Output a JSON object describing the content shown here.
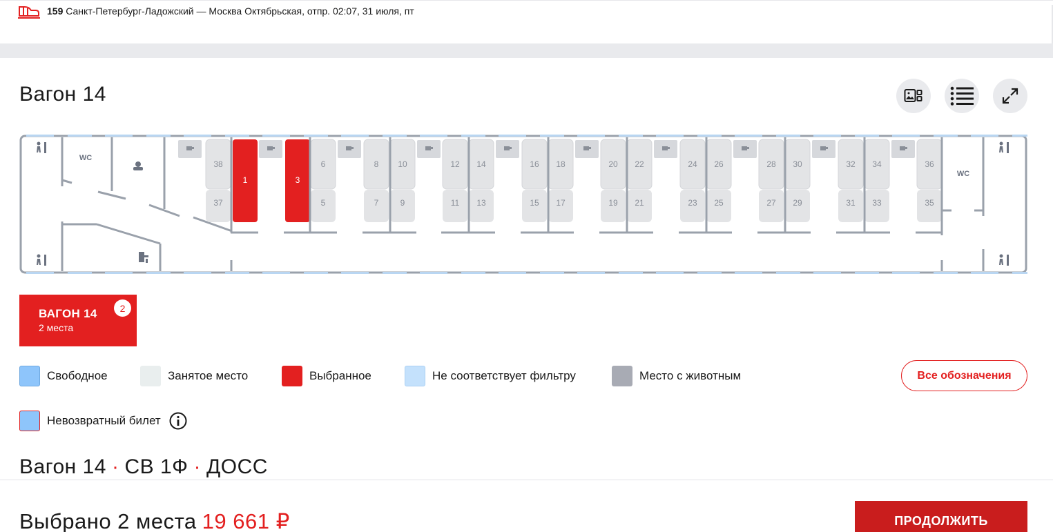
{
  "train": {
    "number": "159",
    "route": "Санкт-Петербург-Ладожский — Москва Октябрьская, отпр. 02:07, 31 июля, пт"
  },
  "wagon": {
    "title": "Вагон 14"
  },
  "toolbar": {
    "gallery_icon": "photo-gallery-icon",
    "list_icon": "list-icon",
    "expand_icon": "expand-icon"
  },
  "scheme": {
    "wc_left": "WC",
    "wc_right": "WC",
    "compartments": [
      {
        "upper": "38",
        "lower": "37",
        "selected": false
      },
      {
        "upper": "1",
        "lower": "",
        "selected": true
      },
      {
        "upper": "3",
        "lower": "",
        "selected": true
      },
      {
        "upper": "6",
        "lower": "5",
        "selected": false
      },
      {
        "upper": "8",
        "lower": "7",
        "selected": false
      },
      {
        "upper": "10",
        "lower": "9",
        "selected": false
      },
      {
        "upper": "12",
        "lower": "11",
        "selected": false
      },
      {
        "upper": "14",
        "lower": "13",
        "selected": false
      },
      {
        "upper": "16",
        "lower": "15",
        "selected": false
      },
      {
        "upper": "18",
        "lower": "17",
        "selected": false
      },
      {
        "upper": "20",
        "lower": "19",
        "selected": false
      },
      {
        "upper": "22",
        "lower": "21",
        "selected": false
      },
      {
        "upper": "24",
        "lower": "23",
        "selected": false
      },
      {
        "upper": "26",
        "lower": "25",
        "selected": false
      },
      {
        "upper": "28",
        "lower": "27",
        "selected": false
      },
      {
        "upper": "30",
        "lower": "29",
        "selected": false
      },
      {
        "upper": "32",
        "lower": "31",
        "selected": false
      },
      {
        "upper": "34",
        "lower": "33",
        "selected": false
      },
      {
        "upper": "36",
        "lower": "35",
        "selected": false
      }
    ]
  },
  "wagon_tab": {
    "title": "ВАГОН 14",
    "subtitle": "2 места",
    "badge": "2"
  },
  "legend": {
    "free": {
      "label": "Свободное",
      "color": "#8ec5fb"
    },
    "occupied": {
      "label": "Занятое место",
      "color": "#e9eeee"
    },
    "selected": {
      "label": "Выбранное",
      "color": "#e32020"
    },
    "not_matching": {
      "label": "Не соответствует фильтру",
      "color": "#c4e1fc"
    },
    "with_animal": {
      "label": "Место с животным",
      "color": "#a8abb4"
    },
    "non_refundable": {
      "label": "Невозвратный билет",
      "color": "#8ec5fb",
      "border": "#e32020"
    },
    "all_button": "Все обозначения"
  },
  "wagon_info": {
    "number": "Вагон 14",
    "class": "СВ 1Ф",
    "carrier": "ДОСС"
  },
  "summary": {
    "selected_text": "Выбрано 2 места",
    "price": "19 661 ₽",
    "continue_label": "ПРОДОЛЖИТЬ"
  },
  "colors": {
    "accent": "#e32020",
    "seat_gray": "#e3e4e6",
    "wall": "#9aa1ab",
    "window": "#b9d6f2"
  }
}
